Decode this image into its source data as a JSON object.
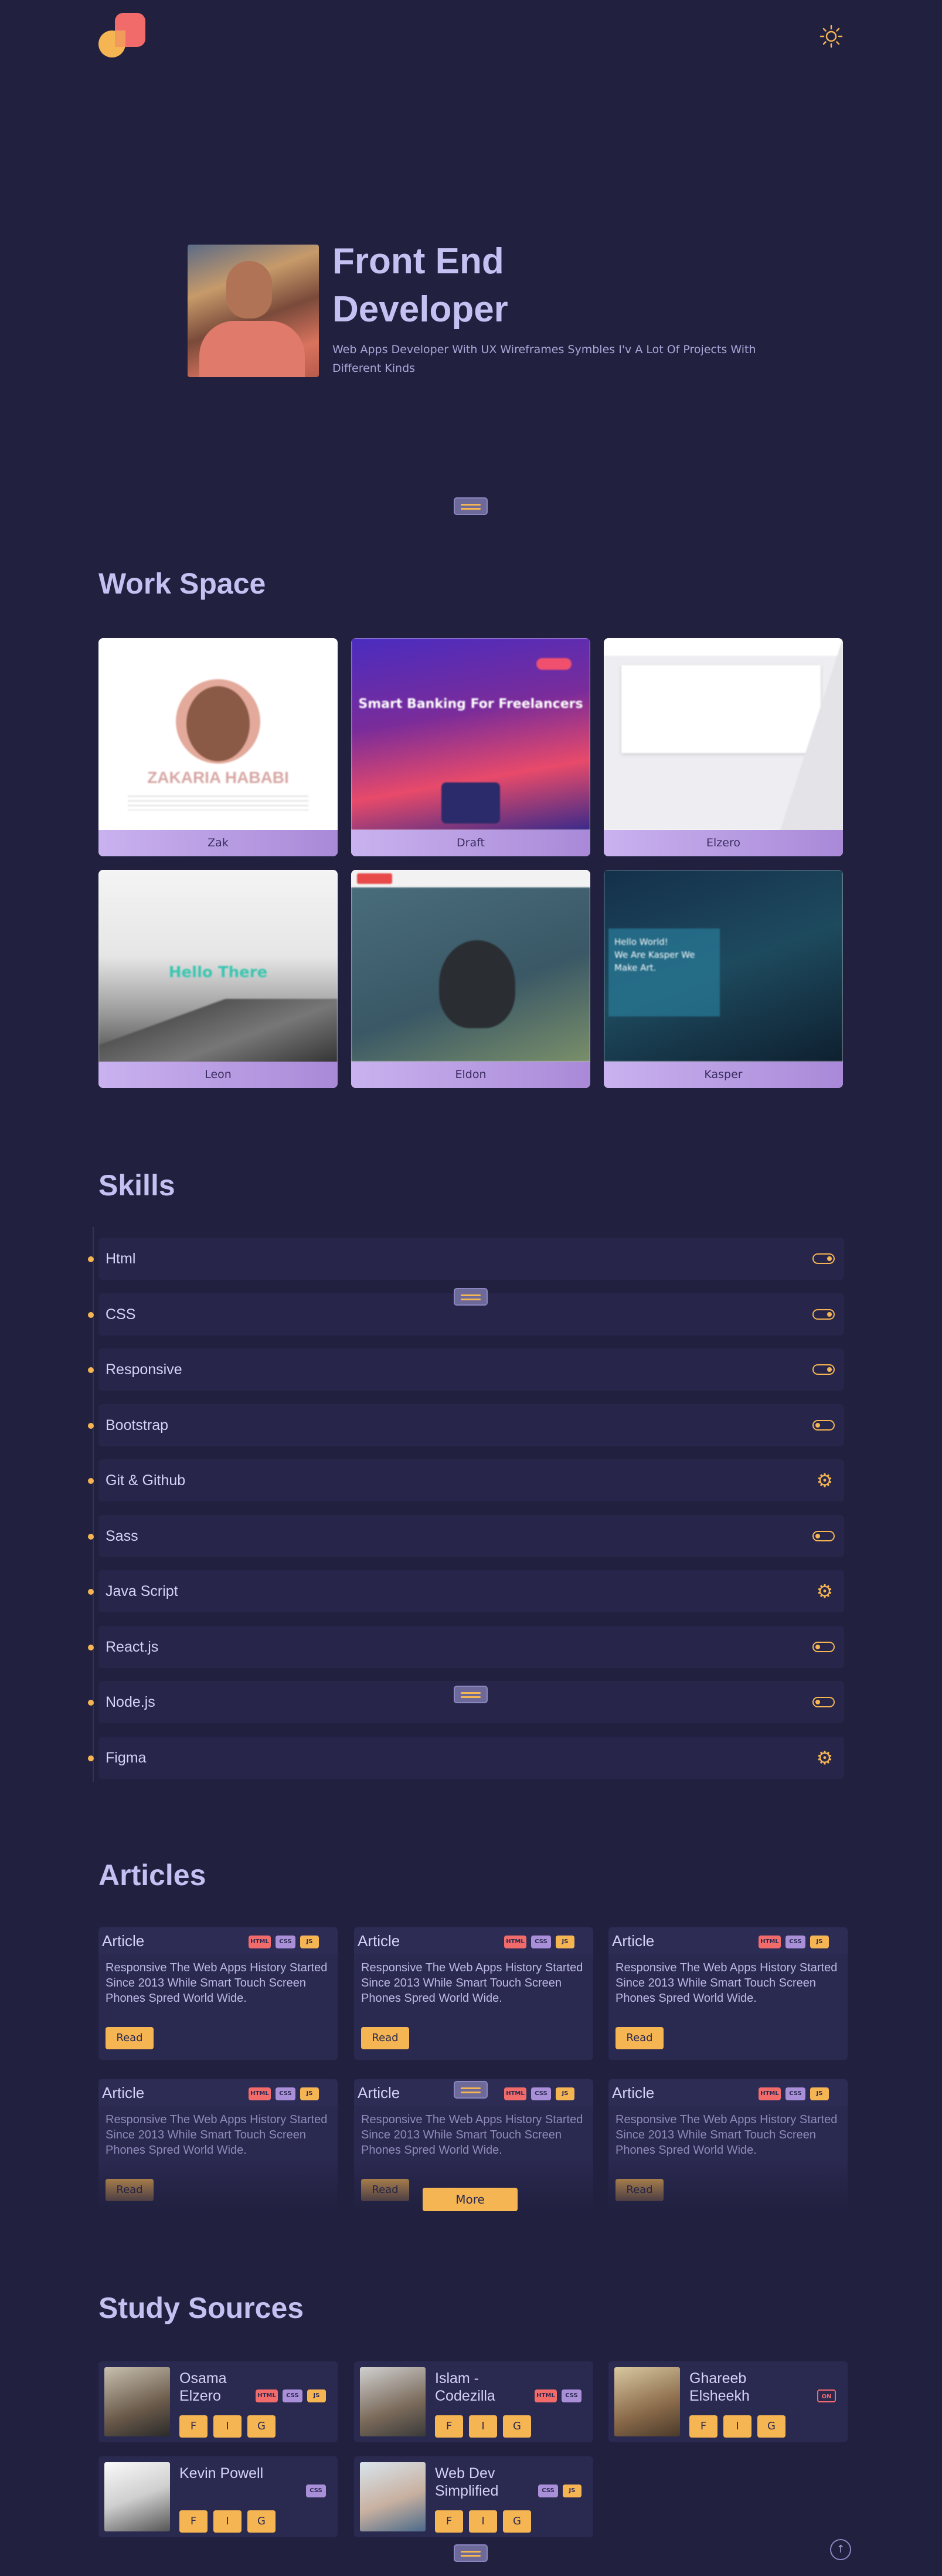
{
  "hero": {
    "title_line1": "Front End",
    "title_line2": "Developer",
    "subtitle": "Web Apps Developer With UX Wireframes Symbles I'v A Lot Of Projects With Different Kinds"
  },
  "work": {
    "title": "Work Space",
    "cards": [
      {
        "name": "Zak"
      },
      {
        "name": "Draft"
      },
      {
        "name": "Elzero"
      },
      {
        "name": "Leon"
      },
      {
        "name": "Eldon"
      },
      {
        "name": "Kasper"
      }
    ]
  },
  "skills": {
    "title": "Skills",
    "items": [
      {
        "label": "Html",
        "icon": "toggle-on-icon"
      },
      {
        "label": "CSS",
        "icon": "toggle-on-icon"
      },
      {
        "label": "Responsive",
        "icon": "toggle-on-icon"
      },
      {
        "label": "Bootstrap",
        "icon": "toggle-off-icon"
      },
      {
        "label": "Git & Github",
        "icon": "gear-icon"
      },
      {
        "label": "Sass",
        "icon": "toggle-off-icon"
      },
      {
        "label": "Java Script",
        "icon": "gear-icon"
      },
      {
        "label": "React.js",
        "icon": "toggle-off-icon"
      },
      {
        "label": "Node.js",
        "icon": "toggle-off-icon"
      },
      {
        "label": "Figma",
        "icon": "gear-icon"
      }
    ]
  },
  "articles": {
    "title": "Articles",
    "card_title": "Article",
    "tags": {
      "html": "HTML",
      "css": "CSS",
      "js": "JS"
    },
    "body": "Responsive The Web Apps History Started Since 2013 While Smart Touch Screen Phones Spred World Wide.",
    "read_label": "Read",
    "more_label": "More"
  },
  "study": {
    "title": "Study Sources",
    "sources": [
      {
        "name": "Osama Elzero",
        "tags": [
          "HTML",
          "CSS",
          "JS"
        ]
      },
      {
        "name": "Islam - Codezilla",
        "tags": [
          "HTML",
          "CSS"
        ]
      },
      {
        "name": "Ghareeb Elsheekh",
        "tags": [
          "ON"
        ]
      },
      {
        "name": "Kevin Powell",
        "tags": [
          "CSS"
        ]
      },
      {
        "name": "Web Dev Simplified",
        "tags": [
          "CSS",
          "JS"
        ]
      }
    ],
    "buttons": [
      "F",
      "I",
      "G"
    ]
  },
  "colors": {
    "bg": "#21203f",
    "accent": "#f6b553",
    "red": "#f26b6b",
    "purple": "#a98fd8"
  }
}
